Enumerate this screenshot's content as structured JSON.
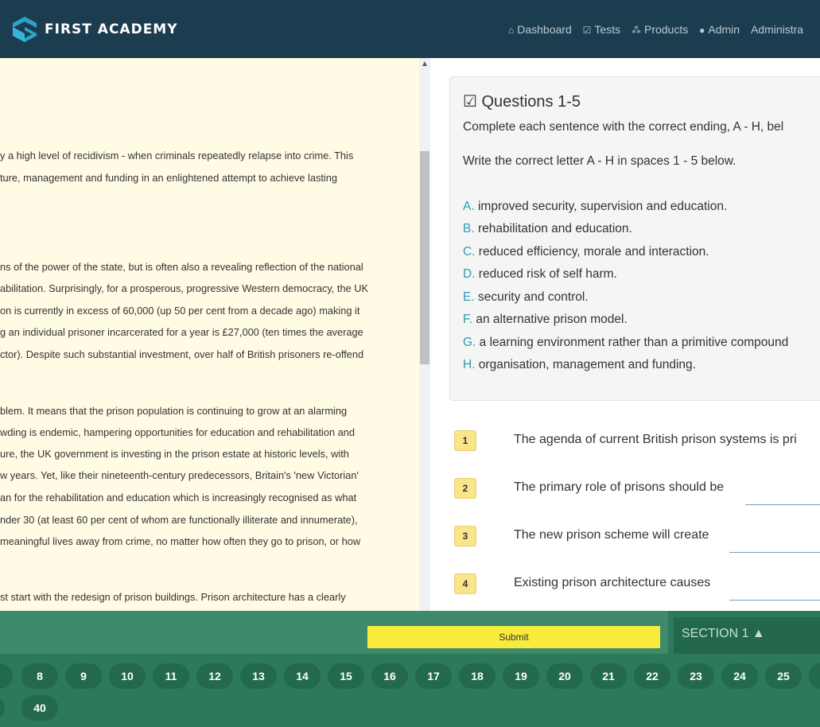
{
  "brand": {
    "name": "FIRST ACADEMY"
  },
  "nav": [
    {
      "icon": "home-icon",
      "glyph": "⌂",
      "label": "Dashboard"
    },
    {
      "icon": "check-square-icon",
      "glyph": "☑",
      "label": "Tests"
    },
    {
      "icon": "cubes-icon",
      "glyph": "⁂",
      "label": "Products"
    },
    {
      "icon": "circle-icon",
      "glyph": "●",
      "label": "Admin"
    },
    {
      "icon": "",
      "glyph": "",
      "label": "Administra"
    }
  ],
  "passage": {
    "lines": [
      "y a  high level of recidivism - when criminals repeatedly relapse into crime. This",
      "ture, management and funding in an enlightened attempt to achieve lasting",
      "ns of the power of the state, but is often also a revealing reflection of the national",
      "abilitation. Surprisingly, for a prosperous, progressive Western democracy, the UK",
      "on is currently in excess of 60,000 (up 50 per cent from a decade ago) making it",
      "g an individual prisoner incarcerated for a year is £27,000 (ten times the average",
      "ctor). Despite such substantial investment, over half of British prisoners re-offend",
      "blem. It means that the prison population is continuing to grow at an alarming",
      "wding is endemic, hampering opportunities for education and rehabilitation and",
      "ure, the UK government is investing in the prison estate at historic levels, with",
      "w years. Yet, like their nineteenth-century predecessors, Britain's 'new Victorian'",
      "an for the rehabilitation and education which is increasingly recognised as what",
      "nder 30 (at least 60 per cent of whom are functionally illiterate and innumerate),",
      " meaningful lives away from crime, no matter how often they go to prison, or how",
      "st start  with the redesign of prison buildings. Prison architecture has a clearly"
    ]
  },
  "questions_box": {
    "title": "Questions 1-5",
    "instruction1": "Complete each sentence with the correct ending, A - H, bel",
    "instruction2": "Write the correct letter A - H in spaces 1 - 5 below.",
    "options": [
      {
        "letter": "A.",
        "text": " improved security, supervision and education."
      },
      {
        "letter": "B.",
        "text": " rehabilitation and education."
      },
      {
        "letter": "C.",
        "text": " reduced efficiency, morale and interaction."
      },
      {
        "letter": "D.",
        "text": " reduced risk of self harm."
      },
      {
        "letter": "E.",
        "text": " security and control."
      },
      {
        "letter": "F.",
        "text": " an alternative prison model."
      },
      {
        "letter": "G.",
        "text": " a learning environment rather than a primitive compound"
      },
      {
        "letter": "H.",
        "text": " organisation, management and funding."
      }
    ]
  },
  "questions": [
    {
      "num": "1",
      "text": "The agenda of current British prison systems is pri"
    },
    {
      "num": "2",
      "text": "The primary role of prisons should be"
    },
    {
      "num": "3",
      "text": "The new prison scheme will create"
    },
    {
      "num": "4",
      "text": "Existing prison architecture causes"
    }
  ],
  "footer": {
    "submit_label": "Submit",
    "section_label": "SECTION 1",
    "section_icon": "warning-icon",
    "question_buttons_row1": [
      "8",
      "9",
      "10",
      "11",
      "12",
      "13",
      "14",
      "15",
      "16",
      "17",
      "18",
      "19",
      "20",
      "21",
      "22",
      "23",
      "24",
      "25"
    ],
    "question_buttons_row2": [
      "40"
    ]
  },
  "colors": {
    "header": "#1c3d4f",
    "passage_bg": "#fffbe4",
    "accent": "#2e9bb3",
    "footer": "#2d7a5a",
    "submit": "#f8eb3b",
    "qnum_bg": "#fbe58a"
  }
}
